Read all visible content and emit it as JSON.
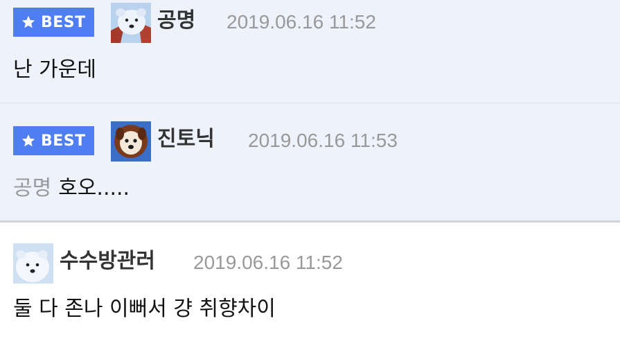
{
  "badge": {
    "label": "BEST",
    "icon": "star-icon",
    "color": "#4f7ef2"
  },
  "comments": [
    {
      "best": true,
      "nickname": "공명",
      "date": "2019.06.16 11:52",
      "reply_to": "",
      "text": "난 가운데",
      "avatar": "polar-bear-avatar"
    },
    {
      "best": true,
      "nickname": "진토닉",
      "date": "2019.06.16 11:53",
      "reply_to": "공명",
      "text": "호오.....",
      "avatar": "puppy-avatar"
    },
    {
      "best": false,
      "nickname": "수수방관러",
      "date": "2019.06.16 11:52",
      "reply_to": "",
      "text": "둘 다 존나 이뻐서 걍 취향차이",
      "avatar": "polar-bear-cub-avatar"
    }
  ]
}
